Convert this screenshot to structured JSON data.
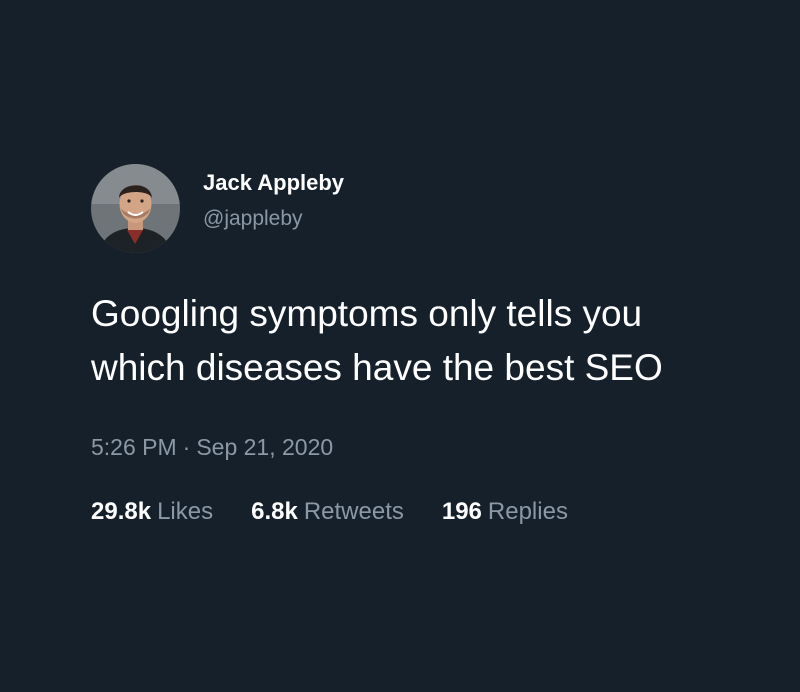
{
  "tweet": {
    "author": {
      "display_name": "Jack Appleby",
      "handle": "@jappleby",
      "avatar_icon": "profile-photo"
    },
    "text": "Googling symptoms only tells you which diseases have the best SEO",
    "time": "5:26 PM",
    "separator": "·",
    "date": "Sep 21, 2020",
    "stats": {
      "likes_count": "29.8k",
      "likes_label": "Likes",
      "retweets_count": "6.8k",
      "retweets_label": "Retweets",
      "replies_count": "196",
      "replies_label": "Replies"
    }
  },
  "colors": {
    "background": "#15202b",
    "primary_text": "#ffffff",
    "secondary_text": "#8b98a5"
  }
}
